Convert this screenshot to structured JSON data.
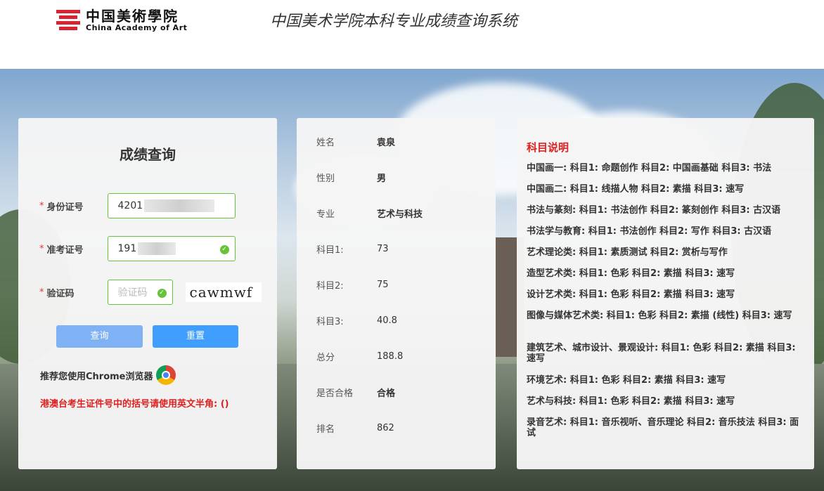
{
  "header": {
    "logo_cn": "中国美術學院",
    "logo_en": "China Academy of Art",
    "system_title": "中国美术学院本科专业成绩查询系统"
  },
  "form": {
    "title": "成绩查询",
    "id_label": "身份证号",
    "id_value": "4201",
    "exam_label": "准考证号",
    "exam_value": "191",
    "captcha_label": "验证码",
    "captcha_placeholder": "验证码",
    "captcha_text": "cawmwf",
    "query_button": "查询",
    "reset_button": "重置",
    "browser_tip": "推荐您使用Chrome浏览器",
    "hk_notice": "港澳台考生证件号中的括号请使用英文半角: ()"
  },
  "result": {
    "rows": [
      {
        "key": "姓名",
        "value": "袁泉",
        "bold": true
      },
      {
        "key": "性别",
        "value": "男",
        "bold": true
      },
      {
        "key": "专业",
        "value": "艺术与科技",
        "bold": true
      },
      {
        "key": "科目1:",
        "value": "73",
        "bold": false
      },
      {
        "key": "科目2:",
        "value": "75",
        "bold": false
      },
      {
        "key": "科目3:",
        "value": "40.8",
        "bold": false
      },
      {
        "key": "总分",
        "value": "188.8",
        "bold": false
      },
      {
        "key": "是否合格",
        "value": "合格",
        "bold": true
      },
      {
        "key": "排名",
        "value": "862",
        "bold": false
      }
    ]
  },
  "notes": {
    "title": "科目说明",
    "items": [
      "中国画一: 科目1: 命题创作 科目2: 中国画基础 科目3: 书法",
      "中国画二: 科目1: 线描人物 科目2: 素描 科目3: 速写",
      "书法与篆刻: 科目1: 书法创作 科目2: 篆刻创作 科目3: 古汉语",
      "书法学与教育: 科目1: 书法创作 科目2: 写作 科目3: 古汉语",
      "艺术理论类: 科目1: 素质测试 科目2: 赏析与写作",
      "造型艺术类: 科目1: 色彩 科目2: 素描 科目3: 速写",
      "设计艺术类: 科目1: 色彩 科目2: 素描 科目3: 速写",
      "图像与媒体艺术类: 科目1: 色彩 科目2: 素描 (线性) 科目3: 速写",
      "建筑艺术、城市设计、景观设计: 科目1: 色彩 科目2: 素描 科目3: 速写",
      "环境艺术: 科目1: 色彩 科目2: 素描 科目3: 速写",
      "艺术与科技: 科目1: 色彩 科目2: 素描 科目3: 速写",
      "录音艺术: 科目1: 音乐视听、音乐理论 科目2: 音乐技法 科目3: 面试"
    ]
  }
}
